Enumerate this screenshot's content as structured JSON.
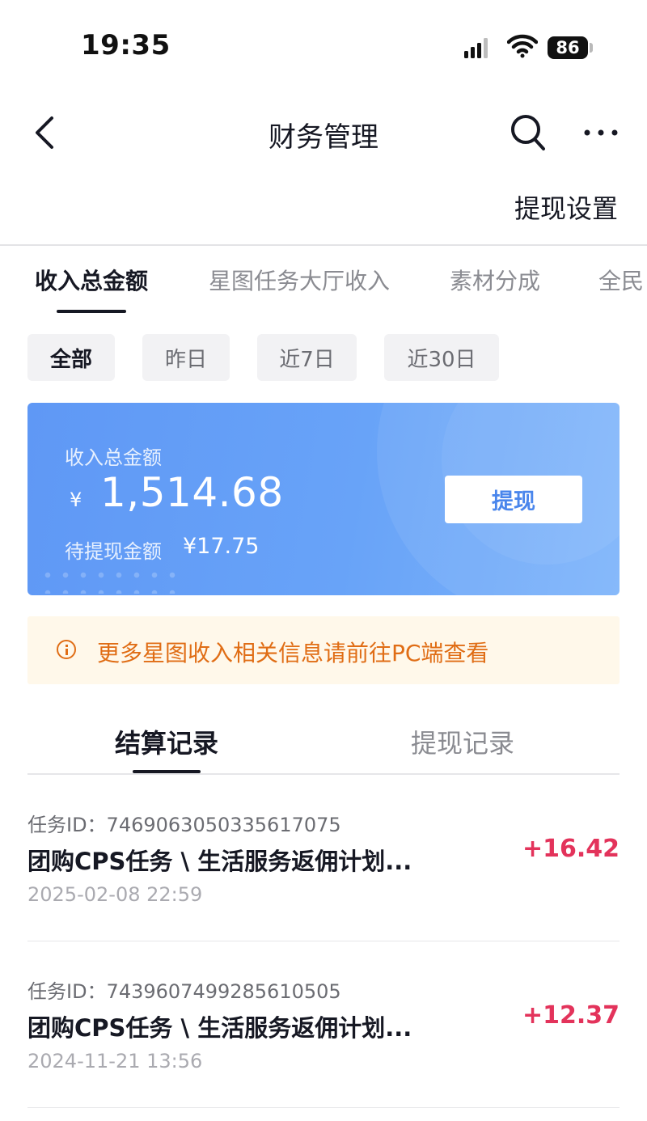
{
  "status_bar": {
    "time": "19:35",
    "battery": "86"
  },
  "nav": {
    "title": "财务管理",
    "right_link": "提现设置"
  },
  "category_tabs": [
    "收入总金额",
    "星图任务大厅收入",
    "素材分成",
    "全民"
  ],
  "filters": [
    "全部",
    "昨日",
    "近7日",
    "近30日"
  ],
  "summary": {
    "label": "收入总金额",
    "currency": "¥",
    "amount": "1,514.68",
    "pending_label": "待提现金额",
    "pending_value": "¥17.75",
    "withdraw_button": "提现"
  },
  "notice": {
    "text": "更多星图收入相关信息请前往PC端查看",
    "color": "#e06d15"
  },
  "record_tabs": [
    "结算记录",
    "提现记录"
  ],
  "records": [
    {
      "id": "任务ID：7469063050335617075",
      "title": "团购CPS任务 \\ 生活服务返佣计划...",
      "date": "2025-02-08 22:59",
      "amount": "+16.42"
    },
    {
      "id": "任务ID：7439607499285610505",
      "title": "团购CPS任务 \\ 生活服务返佣计划...",
      "date": "2024-11-21 13:56",
      "amount": "+12.37"
    }
  ],
  "colors": {
    "accent": "#4a86ec",
    "amount_positive": "#e3335b",
    "card_bg": "#68a3f8"
  }
}
